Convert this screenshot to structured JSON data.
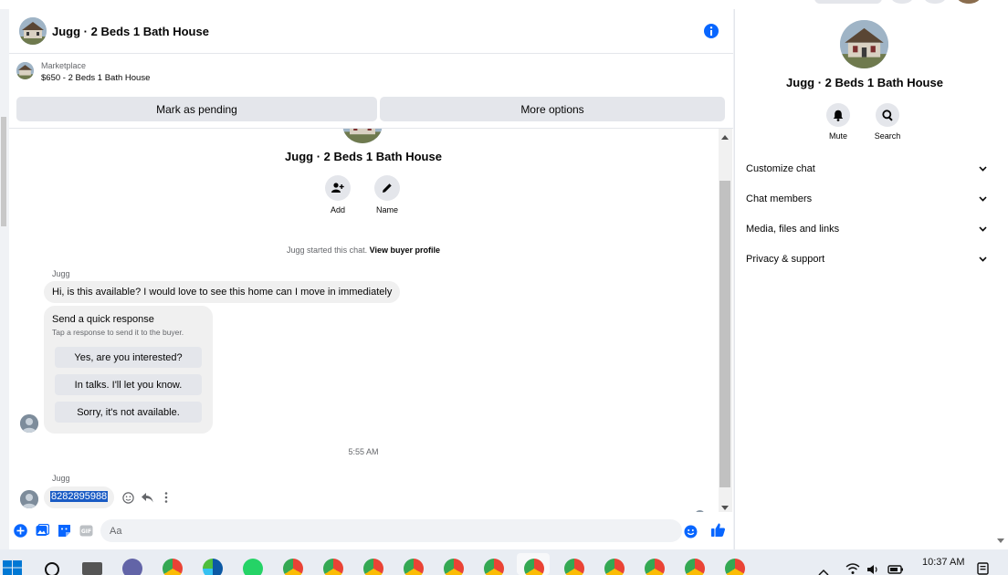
{
  "header": {
    "title": "Jugg · 2 Beds 1 Bath House"
  },
  "marketplace": {
    "label": "Marketplace",
    "listing": "$650 - 2 Beds 1 Bath House",
    "mark_pending": "Mark as pending",
    "more_options": "More options"
  },
  "conversation": {
    "name": "Jugg · 2 Beds 1 Bath House",
    "add_label": "Add",
    "name_label": "Name",
    "system_text": "Jugg started this chat.",
    "system_link": "View buyer profile",
    "timestamp": "5:55 AM"
  },
  "messages": [
    {
      "sender": "Jugg",
      "text": "Hi, is this available? I would love to see this home can I move in immediately"
    },
    {
      "sender": "Jugg",
      "text": "8282895988"
    }
  ],
  "quick_response": {
    "title": "Send a quick response",
    "subtitle": "Tap a response to send it to the buyer.",
    "options": [
      "Yes, are you interested?",
      "In talks. I'll let you know.",
      "Sorry, it's not available."
    ]
  },
  "composer": {
    "placeholder": "Aa"
  },
  "info_panel": {
    "name": "Jugg · 2 Beds 1 Bath House",
    "mute_label": "Mute",
    "search_label": "Search",
    "sections": [
      "Customize chat",
      "Chat members",
      "Media, files and links",
      "Privacy & support"
    ]
  },
  "taskbar": {
    "time": "10:37 AM"
  },
  "colors": {
    "accent": "#0866ff",
    "bubble": "#f0f0f0",
    "button": "#e4e6eb",
    "selection": "#1a5bc4"
  },
  "icons": {
    "info": "info-icon",
    "add_person": "add-person-icon",
    "pencil": "pencil-icon",
    "bell": "bell-icon",
    "search": "search-icon",
    "chevron": "chevron-down-icon",
    "plus": "plus-circle-icon",
    "photo": "photo-icon",
    "sticker": "sticker-icon",
    "gif": "gif-icon",
    "emoji": "emoji-icon",
    "like": "thumbs-up-icon"
  }
}
